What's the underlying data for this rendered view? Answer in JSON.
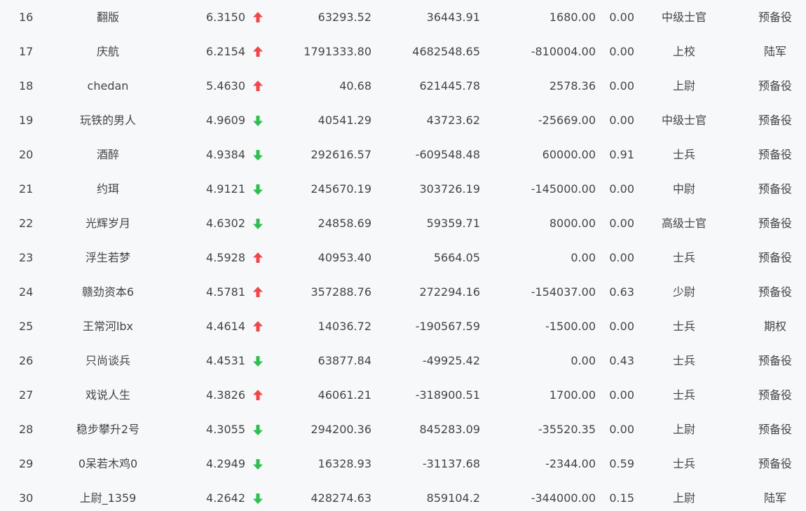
{
  "colors": {
    "background": "#f7f8fa",
    "text": "#444444",
    "trend_up": "#f04848",
    "trend_down": "#2fbf4f"
  },
  "table": {
    "rows": [
      {
        "rank": "16",
        "name": "翻版",
        "score": "6.3150",
        "trend": "up",
        "v1": "63293.52",
        "v2": "36443.91",
        "v3": "1680.00",
        "v4": "0.00",
        "rank_title": "中级士官",
        "type": "预备役"
      },
      {
        "rank": "17",
        "name": "庆航",
        "score": "6.2154",
        "trend": "up",
        "v1": "1791333.80",
        "v2": "4682548.65",
        "v3": "-810004.00",
        "v4": "0.00",
        "rank_title": "上校",
        "type": "陆军"
      },
      {
        "rank": "18",
        "name": "chedan",
        "score": "5.4630",
        "trend": "up",
        "v1": "40.68",
        "v2": "621445.78",
        "v3": "2578.36",
        "v4": "0.00",
        "rank_title": "上尉",
        "type": "预备役"
      },
      {
        "rank": "19",
        "name": "玩铁的男人",
        "score": "4.9609",
        "trend": "down",
        "v1": "40541.29",
        "v2": "43723.62",
        "v3": "-25669.00",
        "v4": "0.00",
        "rank_title": "中级士官",
        "type": "预备役"
      },
      {
        "rank": "20",
        "name": "酒醉",
        "score": "4.9384",
        "trend": "down",
        "v1": "292616.57",
        "v2": "-609548.48",
        "v3": "60000.00",
        "v4": "0.91",
        "rank_title": "士兵",
        "type": "预备役"
      },
      {
        "rank": "21",
        "name": "约珥",
        "score": "4.9121",
        "trend": "down",
        "v1": "245670.19",
        "v2": "303726.19",
        "v3": "-145000.00",
        "v4": "0.00",
        "rank_title": "中尉",
        "type": "预备役"
      },
      {
        "rank": "22",
        "name": "光辉岁月",
        "score": "4.6302",
        "trend": "down",
        "v1": "24858.69",
        "v2": "59359.71",
        "v3": "8000.00",
        "v4": "0.00",
        "rank_title": "高级士官",
        "type": "预备役"
      },
      {
        "rank": "23",
        "name": "浮生若梦",
        "score": "4.5928",
        "trend": "up",
        "v1": "40953.40",
        "v2": "5664.05",
        "v3": "0.00",
        "v4": "0.00",
        "rank_title": "士兵",
        "type": "预备役"
      },
      {
        "rank": "24",
        "name": "赣劲资本6",
        "score": "4.5781",
        "trend": "up",
        "v1": "357288.76",
        "v2": "272294.16",
        "v3": "-154037.00",
        "v4": "0.63",
        "rank_title": "少尉",
        "type": "预备役"
      },
      {
        "rank": "25",
        "name": "王常河lbx",
        "score": "4.4614",
        "trend": "up",
        "v1": "14036.72",
        "v2": "-190567.59",
        "v3": "-1500.00",
        "v4": "0.00",
        "rank_title": "士兵",
        "type": "期权"
      },
      {
        "rank": "26",
        "name": "只尚谈兵",
        "score": "4.4531",
        "trend": "down",
        "v1": "63877.84",
        "v2": "-49925.42",
        "v3": "0.00",
        "v4": "0.43",
        "rank_title": "士兵",
        "type": "预备役"
      },
      {
        "rank": "27",
        "name": "戏说人生",
        "score": "4.3826",
        "trend": "up",
        "v1": "46061.21",
        "v2": "-318900.51",
        "v3": "1700.00",
        "v4": "0.00",
        "rank_title": "士兵",
        "type": "预备役"
      },
      {
        "rank": "28",
        "name": "稳步攀升2号",
        "score": "4.3055",
        "trend": "down",
        "v1": "294200.36",
        "v2": "845283.09",
        "v3": "-35520.35",
        "v4": "0.00",
        "rank_title": "上尉",
        "type": "预备役"
      },
      {
        "rank": "29",
        "name": "0呆若木鸡0",
        "score": "4.2949",
        "trend": "down",
        "v1": "16328.93",
        "v2": "-31137.68",
        "v3": "-2344.00",
        "v4": "0.59",
        "rank_title": "士兵",
        "type": "预备役"
      },
      {
        "rank": "30",
        "name": "上尉_1359",
        "score": "4.2642",
        "trend": "down",
        "v1": "428274.63",
        "v2": "859104.2",
        "v3": "-344000.00",
        "v4": "0.15",
        "rank_title": "上尉",
        "type": "陆军"
      }
    ]
  }
}
